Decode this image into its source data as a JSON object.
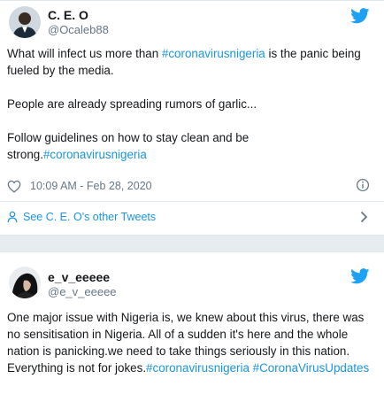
{
  "tweets": [
    {
      "name": "C. E. O",
      "handle": "@Ocaleb88",
      "body": [
        [
          "What will infect us more than ",
          {
            "hashtag": "#coronavirusnigeria"
          },
          " is the panic being fueled by the media."
        ],
        [
          "People are already spreading rumors of garlic..."
        ],
        [
          "Follow guidelines on how to stay clean and be strong.",
          {
            "hashtag": "#coronavirusnigeria"
          }
        ]
      ],
      "timestamp": "10:09 AM - Feb 28, 2020",
      "see_more": "See C. E. O's other Tweets"
    },
    {
      "name": "e_v_eeeee",
      "handle": "@e_v_eeeee",
      "body": [
        [
          "One major issue with Nigeria is, we knew about this virus, there was no sensitisation in Nigeria. All of a sudden it's here and the whole nation is panicking.we need to take things seriously in this nation. Everything is not for jokes.",
          {
            "hashtag": "#coronavirusnigeria"
          },
          " ",
          {
            "hashtag": "#CoronaVirusUpdates"
          }
        ]
      ]
    }
  ],
  "icons": {
    "brand": "twitter-bird-icon",
    "like": "heart-icon",
    "info": "info-icon",
    "profile": "person-icon",
    "expand": "chevron-right-icon"
  },
  "colors": {
    "link": "#1b95e0",
    "brand": "#1da1f2",
    "text": "#14171a",
    "muted": "#657786",
    "border": "#e1e8ed"
  }
}
